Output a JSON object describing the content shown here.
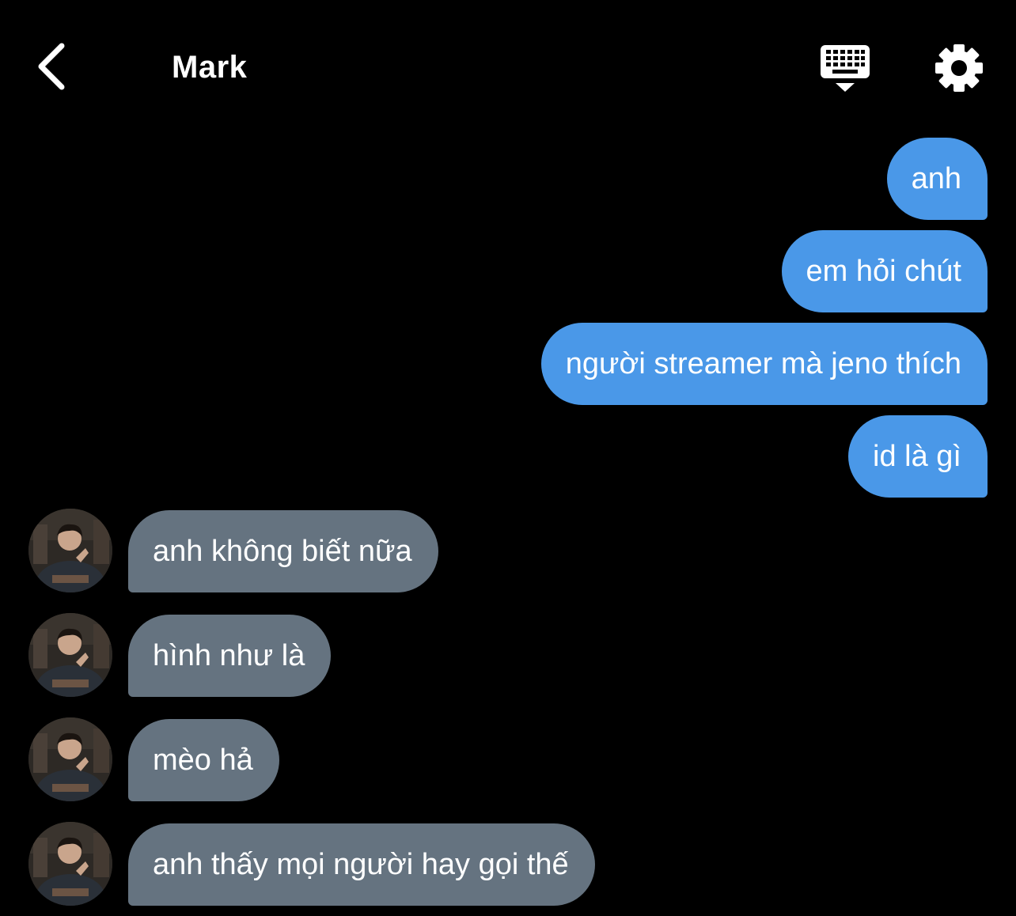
{
  "header": {
    "title": "Mark",
    "icons": {
      "back": "chevron-left-icon",
      "keyboard": "keyboard-icon",
      "settings": "gear-icon"
    }
  },
  "messages": [
    {
      "side": "out",
      "text": "anh"
    },
    {
      "side": "out",
      "text": "em hỏi chút"
    },
    {
      "side": "out",
      "text": "người streamer mà jeno thích"
    },
    {
      "side": "out",
      "text": "id là gì"
    },
    {
      "side": "in",
      "text": "anh không biết nữa"
    },
    {
      "side": "in",
      "text": "hình như là"
    },
    {
      "side": "in",
      "text": "mèo hả"
    },
    {
      "side": "in",
      "text": "anh thấy mọi người hay gọi thế"
    }
  ],
  "colors": {
    "background": "#000000",
    "outgoing_bubble": "#4a98e8",
    "incoming_bubble": "#657380",
    "text": "#ffffff"
  }
}
